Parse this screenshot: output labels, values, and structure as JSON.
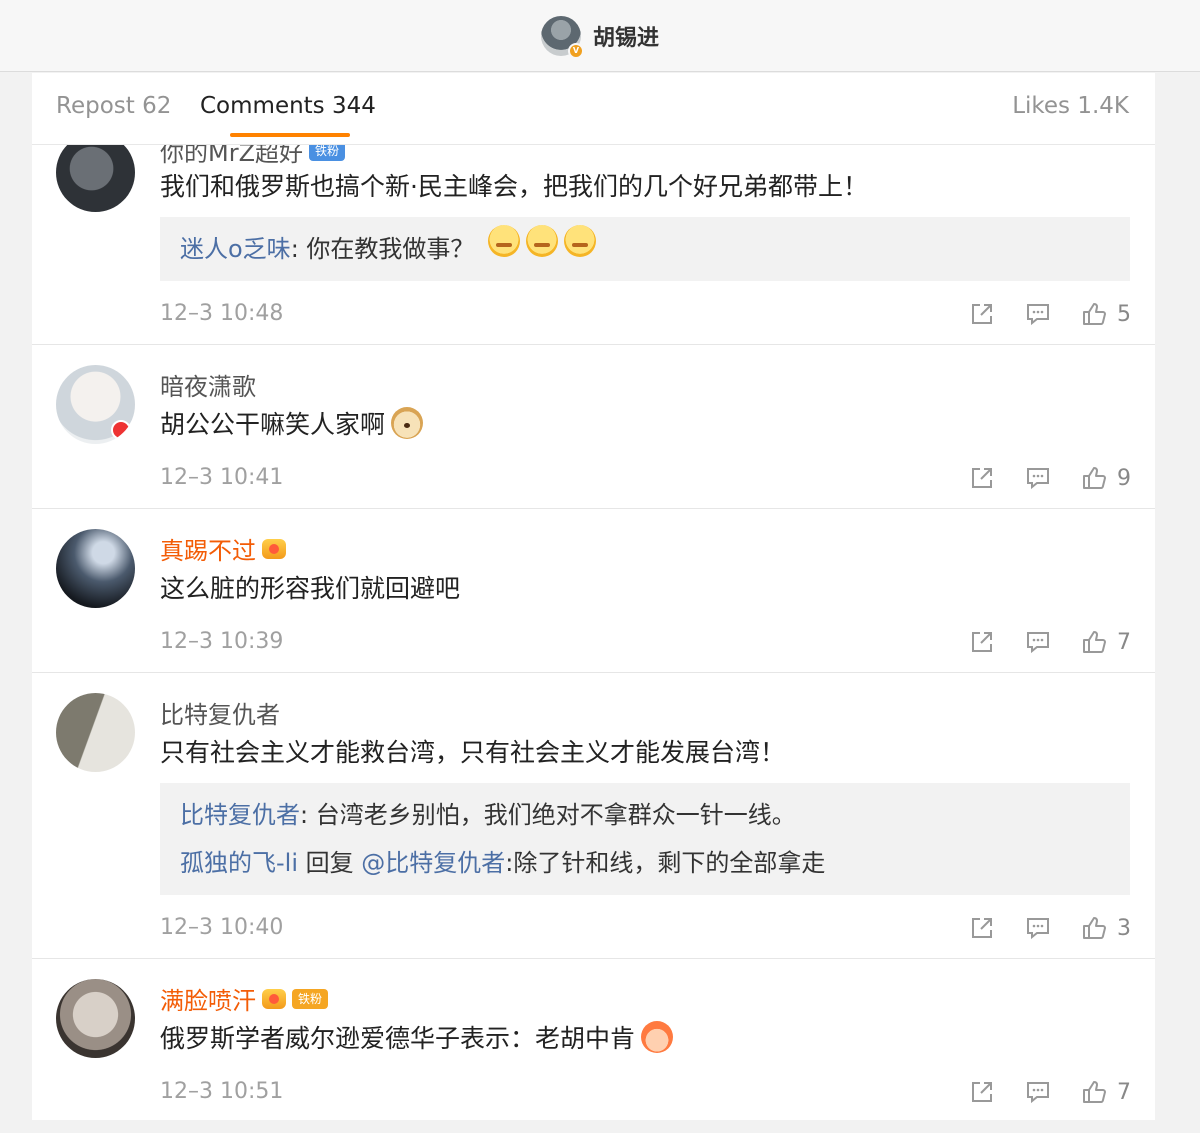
{
  "header": {
    "username": "胡锡进",
    "badge": "V"
  },
  "tabs": {
    "repost": "Repost 62",
    "comments": "Comments 344",
    "likes": "Likes 1.4K"
  },
  "comments": [
    {
      "name": "你的MrZ超好",
      "badge": "铁粉",
      "text": "我们和俄罗斯也搞个新·民主峰会，把我们的几个好兄弟都带上！",
      "replies": [
        {
          "user": "迷人o乏味",
          "text": ": 你在教我做事？"
        }
      ],
      "time": "12–3 10:48",
      "likes": "5"
    },
    {
      "name": "暗夜潇歌",
      "text": "胡公公干嘛笑人家啊",
      "time": "12–3 10:41",
      "likes": "9"
    },
    {
      "name": "真踢不过",
      "text": "这么脏的形容我们就回避吧",
      "time": "12–3 10:39",
      "likes": "7"
    },
    {
      "name": "比特复仇者",
      "text": "只有社会主义才能救台湾，只有社会主义才能发展台湾！",
      "replies": [
        {
          "user": "比特复仇者",
          "text": ": 台湾老乡别怕，我们绝对不拿群众一针一线。"
        },
        {
          "user": "孤独的飞-li",
          "mid": " 回复 ",
          "mention": "@比特复仇者",
          "text": ":除了针和线，剩下的全部拿走"
        }
      ],
      "time": "12–3 10:40",
      "likes": "3"
    },
    {
      "name": "满脸喷汗",
      "badge": "铁粉",
      "text": "俄罗斯学者威尔逊爱德华子表示：老胡中肯",
      "time": "12–3 10:51",
      "likes": "7"
    }
  ],
  "colors": {
    "accent": "#ff8200",
    "link": "#4c6fa5",
    "vip_name": "#f35c06"
  },
  "icons": {
    "share": "share-icon",
    "comment": "comment-icon",
    "like": "thumbs-up-icon"
  }
}
